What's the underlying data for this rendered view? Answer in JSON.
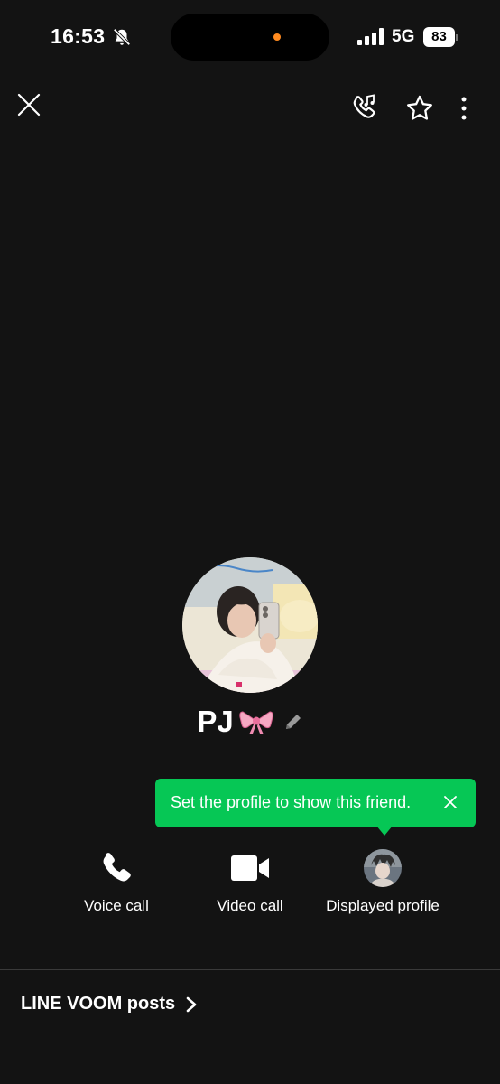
{
  "status_bar": {
    "time": "16:53",
    "network": "5G",
    "battery": "83",
    "icons": [
      "bell-slash-icon",
      "signal-icon",
      "battery-icon"
    ]
  },
  "top_bar": {
    "icons": [
      "close-icon",
      "ringtone-call-icon",
      "star-icon",
      "more-vertical-icon"
    ]
  },
  "profile": {
    "name": "PJ",
    "name_emoji_icon": "ribbon-icon",
    "edit_icon": "pencil-icon"
  },
  "tooltip": {
    "text": "Set the profile to show this friend.",
    "color": "#06c755"
  },
  "actions": [
    {
      "label": "Voice call",
      "icon": "phone-icon"
    },
    {
      "label": "Video call",
      "icon": "video-camera-icon"
    },
    {
      "label": "Displayed profile",
      "icon": "avatar-thumbnail"
    }
  ],
  "voom": {
    "label": "LINE VOOM posts"
  },
  "colors": {
    "background": "#131313",
    "accent": "#06c755",
    "status_dot": "#ff8a1f"
  }
}
